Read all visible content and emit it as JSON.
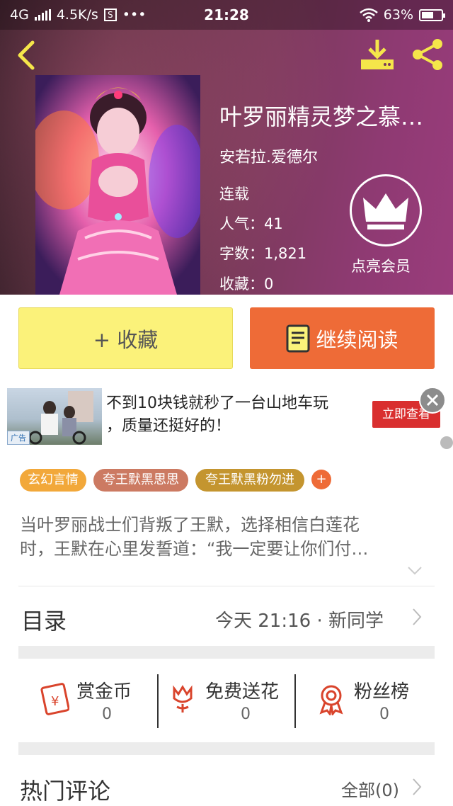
{
  "statusbar": {
    "network": "4G",
    "speed": "4.5K/s",
    "sim": "S",
    "more": "•••",
    "time": "21:28",
    "battery": "63%",
    "battery_level": 0.63
  },
  "book": {
    "title": "叶罗丽精灵梦之慕…",
    "author": "安若拉.爱德尔",
    "status": "连载",
    "popularity": "人气：41",
    "word_count": "字数：1,821",
    "favorites": "收藏：0",
    "member_label": "点亮会员"
  },
  "actions": {
    "favorite": "+ 收藏",
    "continue_reading": "继续阅读"
  },
  "ad": {
    "tag": "广告",
    "line1": "不到10块钱就秒了一台山地车玩",
    "line2": "，质量还挺好的！",
    "button": "立即查看"
  },
  "tags": [
    {
      "label": "玄幻言情",
      "color": "#f2a83a"
    },
    {
      "label": "夸王默黑思思",
      "color": "#cc7a62"
    },
    {
      "label": "夸王默黑粉勿进",
      "color": "#c4952f"
    }
  ],
  "tags_plus": "+",
  "synopsis": {
    "line1": "当叶罗丽战士们背叛了王默，选择相信白莲花",
    "line2": "时，王默在心里发誓道：“我一定要让你们付…"
  },
  "toc": {
    "label": "目录",
    "update": "今天 21:16 · 新同学"
  },
  "stats": [
    {
      "label": "赏金币",
      "value": "0"
    },
    {
      "label": "免费送花",
      "value": "0"
    },
    {
      "label": "粉丝榜",
      "value": "0"
    }
  ],
  "comments": {
    "label": "热门评论",
    "all": "全部(0)"
  },
  "colors": {
    "accent_orange": "#ee6b37",
    "accent_yellow": "#fbf27a",
    "icon_red": "#d9442c",
    "header_icon_yellow": "#f5e64a"
  }
}
